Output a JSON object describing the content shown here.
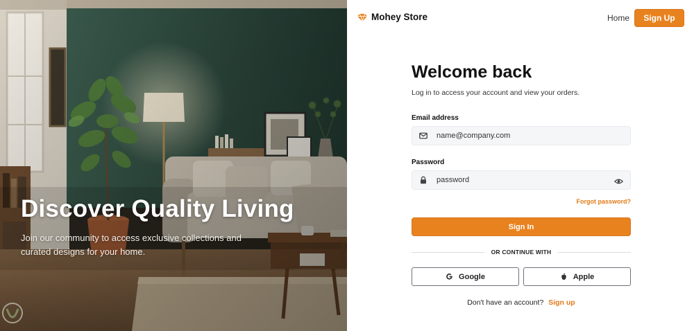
{
  "hero": {
    "title": "Discover Quality Living",
    "subtitle": "Join our community to access exclusive collections and curated designs for your home."
  },
  "header": {
    "brand": "Mohey Store",
    "nav_home": "Home",
    "nav_signup": "Sign Up"
  },
  "form": {
    "title": "Welcome back",
    "subtitle": "Log in to access your account and view your orders.",
    "email_label": "Email address",
    "email_placeholder": "name@company.com",
    "password_label": "Password",
    "password_placeholder": "password",
    "forgot": "Forgot password?",
    "signin": "Sign In",
    "divider": "OR CONTINUE WITH",
    "google": "Google",
    "apple": "Apple",
    "no_account": "Don't have an account?",
    "signup_link": "Sign up"
  },
  "colors": {
    "accent": "#e8821f",
    "accent_text": "#e07a17",
    "wall": "#2e4a3f"
  },
  "icons": [
    "brand-gem-icon",
    "mail-icon",
    "lock-icon",
    "eye-icon",
    "google-icon",
    "apple-icon"
  ]
}
